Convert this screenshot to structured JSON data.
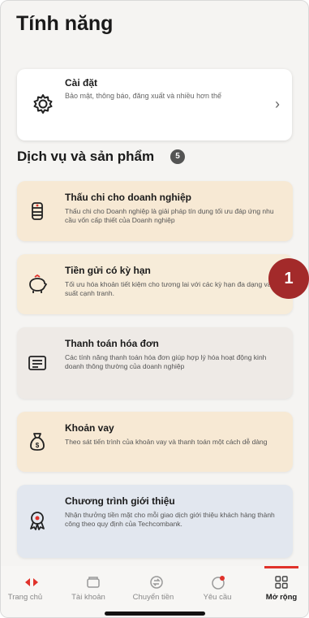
{
  "page": {
    "title": "Tính năng"
  },
  "settings": {
    "title": "Cài đặt",
    "description": "Bảo mật, thông báo, đăng xuất và nhiều hơn thế",
    "icon": "gear-icon",
    "chevron_icon": "chevron-right-icon"
  },
  "services": {
    "title": "Dịch vụ và sản phẩm",
    "count": "5",
    "items": [
      {
        "title": "Thấu chi cho doanh nghiệp",
        "description": "Thấu chi cho Doanh nghiệp là giải pháp tín dụng tối ưu đáp ứng nhu cầu vốn cấp thiết của Doanh nghiệp",
        "icon": "money-stack-icon",
        "color": "#f7e9d4"
      },
      {
        "title": "Tiền gửi có kỳ hạn",
        "description": "Tối ưu hóa khoản tiết kiệm cho tương lai với các kỳ hạn đa dạng và lãi suất cạnh tranh.",
        "icon": "piggy-bank-icon",
        "color": "#f7ecd9"
      },
      {
        "title": "Thanh toán hóa đơn",
        "description": "Các tính năng thanh toán hóa đơn giúp hợp lý hóa hoạt động kinh doanh thông thường của doanh nghiệp",
        "icon": "bill-icon",
        "color": "#eeeae6"
      },
      {
        "title": "Khoản vay",
        "description": "Theo sát tiến trình của khoản vay và thanh toán một cách dễ dàng",
        "icon": "money-bag-icon",
        "color": "#f7e9d4"
      },
      {
        "title": "Chương trình giới thiệu",
        "description": "Nhận thưởng tiền mặt cho mỗi giao dịch giới thiệu khách hàng thành công theo quy định của Techcombank.",
        "icon": "award-icon",
        "color": "#e2e7ef"
      }
    ]
  },
  "step_badge": {
    "label": "1",
    "color": "#a32a2a"
  },
  "bottom_nav": {
    "items": [
      {
        "label": "Trang chủ",
        "icon": "techcombank-logo-icon"
      },
      {
        "label": "Tài khoản",
        "icon": "wallet-icon"
      },
      {
        "label": "Chuyển tiền",
        "icon": "transfer-icon"
      },
      {
        "label": "Yêu cầu",
        "icon": "request-icon"
      },
      {
        "label": "Mở rộng",
        "icon": "grid-icon",
        "active": true
      }
    ]
  },
  "colors": {
    "brand_red": "#e0322b",
    "card_bg": "#ffffff",
    "page_bg": "#f5f4f2"
  }
}
